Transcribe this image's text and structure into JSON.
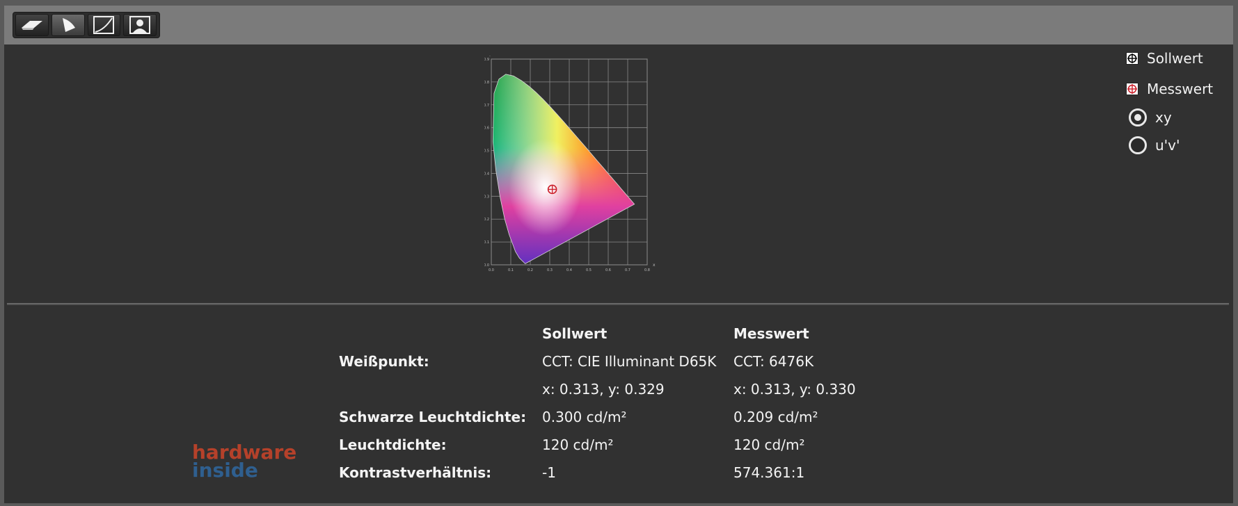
{
  "toolbar": {
    "buttons": [
      {
        "icon": "eraser-icon",
        "active": false
      },
      {
        "icon": "gamut-triangle-icon",
        "active": true
      },
      {
        "icon": "gamma-curve-icon",
        "active": false
      },
      {
        "icon": "person-portrait-icon",
        "active": false
      }
    ]
  },
  "chart": {
    "x_axis_letter": "x",
    "y_axis_letter": "y",
    "x_ticks": [
      "0.0",
      "0.1",
      "0.2",
      "0.3",
      "0.4",
      "0.5",
      "0.6",
      "0.7",
      "0.8"
    ],
    "y_ticks": [
      "0.0",
      "0.1",
      "0.2",
      "0.3",
      "0.4",
      "0.5",
      "0.6",
      "0.7",
      "0.8",
      "0.9"
    ],
    "target_point": {
      "x": 0.313,
      "y": 0.329
    },
    "measured_point": {
      "x": 0.313,
      "y": 0.33
    }
  },
  "legend": {
    "target_label": "Sollwert",
    "measured_label": "Messwert",
    "target_color": "#ffffff",
    "measured_color": "#cc1f2a"
  },
  "options": {
    "xy_label": "xy",
    "uv_label": "u'v'",
    "selected": "xy"
  },
  "results": {
    "col_target": "Sollwert",
    "col_measured": "Messwert",
    "rows": [
      {
        "label": "Weißpunkt:",
        "target": "CCT: CIE Illuminant D65K",
        "measured": "CCT: 6476K"
      },
      {
        "label": "",
        "target": "x: 0.313, y: 0.329",
        "measured": "x: 0.313, y: 0.330"
      },
      {
        "label": "Schwarze Leuchtdichte:",
        "target": "0.300 cd/m²",
        "measured": "0.209 cd/m²"
      },
      {
        "label": "Leuchtdichte:",
        "target": "120 cd/m²",
        "measured": "120 cd/m²"
      },
      {
        "label": "Kontrastverhältnis:",
        "target": "-1",
        "measured": "574.361:1"
      }
    ]
  },
  "watermark": {
    "line1": "hardware",
    "line2": "inside"
  }
}
